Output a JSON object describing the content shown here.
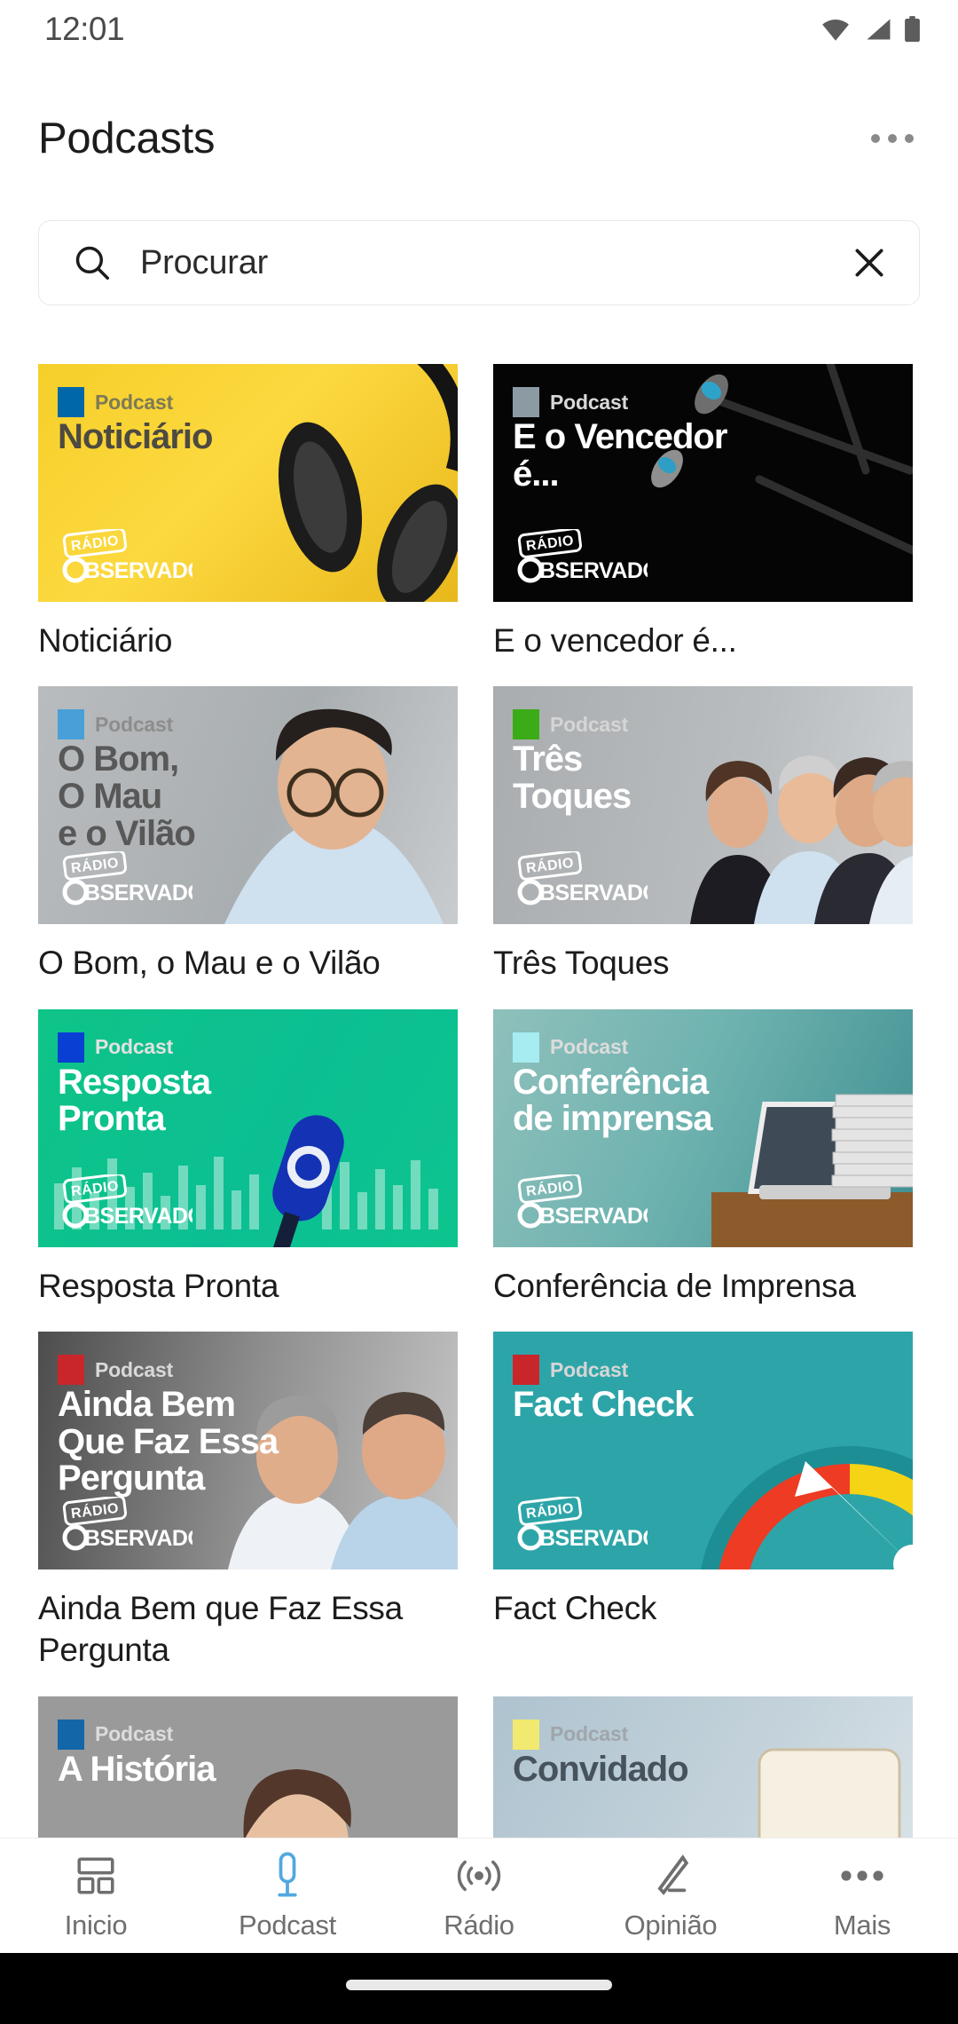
{
  "status_bar": {
    "time": "12:01",
    "icons": [
      "wifi-icon",
      "signal-icon",
      "battery-icon"
    ]
  },
  "header": {
    "title": "Podcasts",
    "overflow_icon": "more-options-icon"
  },
  "search": {
    "placeholder": "Procurar",
    "value": "Procurar",
    "search_icon": "search-icon",
    "clear_icon": "close-icon"
  },
  "grid": {
    "brand_logo_line1": "RÁDIO",
    "brand_logo_line2": "OBSERVADOR",
    "badge_label": "Podcast",
    "rows": [
      [
        {
          "caption": "Noticiário",
          "art_title": "Noticiário",
          "badge_color": "#0068a8",
          "badge_text_color": "#7d7a55",
          "title_color": "#4d4a42",
          "bg": "yellow",
          "logo_color": "#ffffff"
        },
        {
          "caption": "E o vencedor é...",
          "art_title": "E o Vencedor é...",
          "badge_color": "#8c9aa3",
          "badge_text_color": "#d8d8d8",
          "title_color": "#ffffff",
          "bg": "dark",
          "logo_color": "#ffffff"
        }
      ],
      [
        {
          "caption": "O Bom, o Mau e o Vilão",
          "art_title": "O Bom,\nO Mau\ne o Vilão",
          "badge_color": "#49a0d8",
          "badge_text_color": "#8d8d8d",
          "title_color": "#585858",
          "bg": "grey",
          "logo_color": "#ffffff"
        },
        {
          "caption": "Três Toques",
          "art_title": "Três\nToques",
          "badge_color": "#3cab18",
          "badge_text_color": "#d5d5d5",
          "title_color": "#ffffff",
          "bg": "grey2",
          "logo_color": "#ffffff"
        }
      ],
      [
        {
          "caption": "Resposta Pronta",
          "art_title": "Resposta\nPronta",
          "badge_color": "#0a3fd4",
          "badge_text_color": "#e2e2e2",
          "title_color": "#ffffff",
          "bg": "green",
          "logo_color": "#ffffff"
        },
        {
          "caption": "Conferência de Imprensa",
          "art_title": "Conferência\nde imprensa",
          "badge_color": "#a6ecf0",
          "badge_text_color": "#dcdcdc",
          "title_color": "#ffffff",
          "bg": "teal",
          "logo_color": "#ffffff"
        }
      ],
      [
        {
          "caption": "Ainda Bem que Faz Essa Pergunta",
          "art_title": "Ainda Bem\nQue Faz Essa\nPergunta",
          "badge_color": "#c8262a",
          "badge_text_color": "#d9d9d9",
          "title_color": "#ffffff",
          "bg": "greydark",
          "logo_color": "#ffffff"
        },
        {
          "caption": "Fact Check",
          "art_title": "Fact Check",
          "badge_color": "#c8262a",
          "badge_text_color": "#d6d6d6",
          "title_color": "#ffffff",
          "bg": "tealdark",
          "logo_color": "#ffffff"
        }
      ],
      [
        {
          "caption": "",
          "art_title": "A História",
          "badge_color": "#1366a8",
          "badge_text_color": "#dcdcdc",
          "title_color": "#ffffff",
          "bg": "greyflat",
          "logo_color": "#ffffff"
        },
        {
          "caption": "",
          "art_title": "Convidado",
          "badge_color": "#f2ea70",
          "badge_text_color": "#9fa6ab",
          "title_color": "#46525c",
          "bg": "bluegrey",
          "logo_color": "#ffffff"
        }
      ]
    ]
  },
  "bottom_nav": {
    "active_index": 1,
    "active_color": "#51a8e0",
    "inactive_color": "#6f6f6f",
    "items": [
      {
        "label": "Inicio",
        "icon": "dashboard-icon"
      },
      {
        "label": "Podcast",
        "icon": "microphone-icon"
      },
      {
        "label": "Rádio",
        "icon": "broadcast-icon"
      },
      {
        "label": "Opinião",
        "icon": "pencil-icon"
      },
      {
        "label": "Mais",
        "icon": "more-icon"
      }
    ]
  }
}
